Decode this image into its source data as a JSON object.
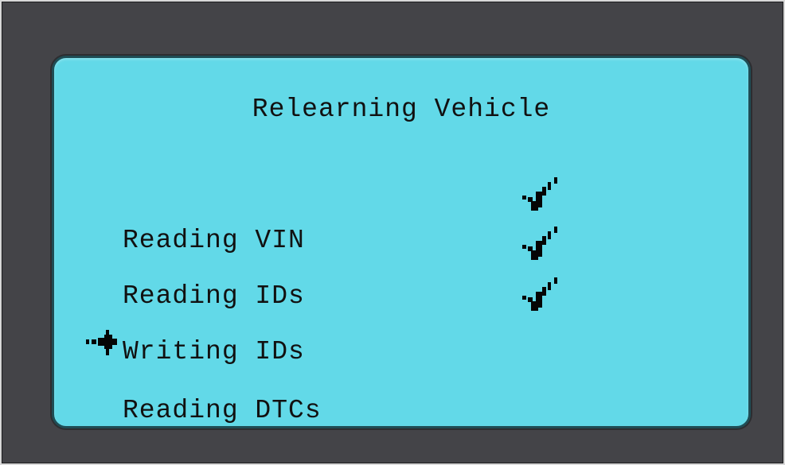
{
  "screen": {
    "title": "Relearning Vehicle",
    "steps": [
      {
        "label": "Reading VIN",
        "completed": true,
        "current": false
      },
      {
        "label": "Reading IDs",
        "completed": true,
        "current": false
      },
      {
        "label": "Writing IDs",
        "completed": false,
        "current": true
      },
      {
        "label": "Reading DTCs",
        "completed": false,
        "current": false
      }
    ],
    "status_icons": [
      "checkmark-icon",
      "checkmark-icon",
      "checkmark-icon"
    ],
    "current_step_icon": "pointer-arrow-icon"
  },
  "colors": {
    "screen_background": "#62d9e8",
    "frame_background": "#444448",
    "text": "#111111"
  }
}
